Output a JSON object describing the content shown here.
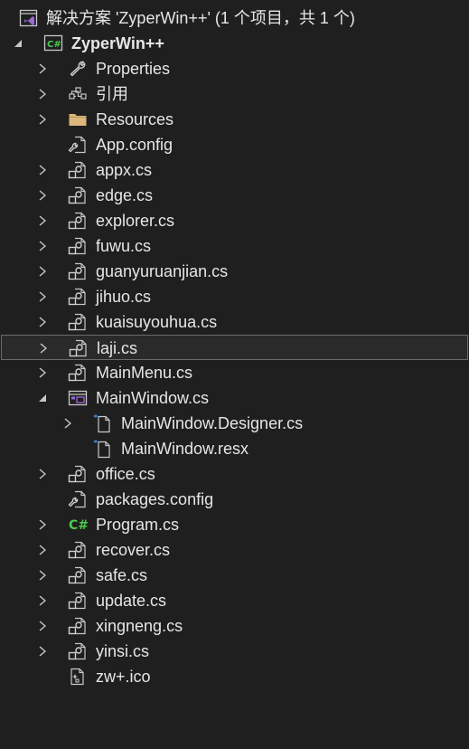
{
  "solution": {
    "label": "解决方案 'ZyperWin++' (1 个项目，共 1 个)",
    "icon": "solution-icon"
  },
  "project": {
    "label": "ZyperWin++",
    "icon": "csharp-project-icon",
    "state": "expanded"
  },
  "items": [
    {
      "label": "Properties",
      "icon": "wrench-icon",
      "expander": "collapsed"
    },
    {
      "label": "引用",
      "icon": "references-icon",
      "expander": "collapsed"
    },
    {
      "label": "Resources",
      "icon": "folder-icon",
      "expander": "collapsed"
    },
    {
      "label": "App.config",
      "icon": "config-file-icon",
      "expander": "none"
    },
    {
      "label": "appx.cs",
      "icon": "cs-class-file-icon",
      "expander": "collapsed"
    },
    {
      "label": "edge.cs",
      "icon": "cs-class-file-icon",
      "expander": "collapsed"
    },
    {
      "label": "explorer.cs",
      "icon": "cs-class-file-icon",
      "expander": "collapsed"
    },
    {
      "label": "fuwu.cs",
      "icon": "cs-class-file-icon",
      "expander": "collapsed"
    },
    {
      "label": "guanyuruanjian.cs",
      "icon": "cs-class-file-icon",
      "expander": "collapsed"
    },
    {
      "label": "jihuo.cs",
      "icon": "cs-class-file-icon",
      "expander": "collapsed"
    },
    {
      "label": "kuaisuyouhua.cs",
      "icon": "cs-class-file-icon",
      "expander": "collapsed"
    },
    {
      "label": "laji.cs",
      "icon": "cs-class-file-icon",
      "expander": "collapsed",
      "selected": true
    },
    {
      "label": "MainMenu.cs",
      "icon": "cs-class-file-icon",
      "expander": "collapsed"
    },
    {
      "label": "MainWindow.cs",
      "icon": "form-icon",
      "expander": "expanded"
    },
    {
      "label": "MainWindow.Designer.cs",
      "icon": "dependent-file-icon",
      "expander": "collapsed",
      "child": true
    },
    {
      "label": "MainWindow.resx",
      "icon": "dependent-file-icon",
      "expander": "none",
      "child": true
    },
    {
      "label": "office.cs",
      "icon": "cs-class-file-icon",
      "expander": "collapsed"
    },
    {
      "label": "packages.config",
      "icon": "config-file-icon",
      "expander": "none"
    },
    {
      "label": "Program.cs",
      "icon": "csharp-file-icon",
      "expander": "collapsed"
    },
    {
      "label": "recover.cs",
      "icon": "cs-class-file-icon",
      "expander": "collapsed"
    },
    {
      "label": "safe.cs",
      "icon": "cs-class-file-icon",
      "expander": "collapsed"
    },
    {
      "label": "update.cs",
      "icon": "cs-class-file-icon",
      "expander": "collapsed"
    },
    {
      "label": "xingneng.cs",
      "icon": "cs-class-file-icon",
      "expander": "collapsed"
    },
    {
      "label": "yinsi.cs",
      "icon": "cs-class-file-icon",
      "expander": "collapsed"
    },
    {
      "label": "zw+.ico",
      "icon": "ico-file-icon",
      "expander": "none"
    }
  ],
  "colors": {
    "background": "#1f1f1f",
    "text": "#e6e6e6",
    "selection_border": "#6b6b6b",
    "csharp_green": "#4ec94e",
    "visual_studio_purple": "#9b6ad6",
    "folder_yellow": "#dcb67a",
    "link_blue": "#3794ff"
  }
}
